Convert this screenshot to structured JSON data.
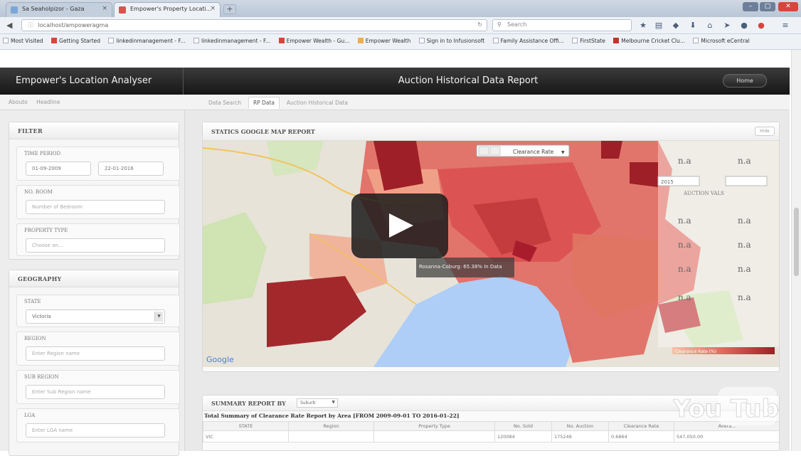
{
  "browser": {
    "tabs": [
      {
        "label": "Sa Seaholpizor - Gaza"
      },
      {
        "label": "Empower's Property Locati..."
      }
    ],
    "url": "localhost/ampoweragma",
    "search_placeholder": "Search",
    "bookmarks": [
      "Most Visited",
      "Getting Started",
      "linkedinmanagement - F...",
      "linkedinmanagement - F...",
      "Empower Wealth - Gu...",
      "Empower Wealth",
      "Sign in to Infusionsoft",
      "Family Assistance Offi...",
      "FirstState",
      "Melbourne Cricket Clu...",
      "Microsoft eCentral"
    ]
  },
  "header": {
    "app_name": "Empower's Location Analyser",
    "report_title": "Auction Historical Data Report",
    "home_label": "Home"
  },
  "subnav": {
    "left_links": [
      "Abouto",
      "Headline"
    ],
    "tabs": [
      "Data Search",
      "RP Data",
      "Auction Historical Data"
    ]
  },
  "filter": {
    "title": "FILTER",
    "time_period_label": "TIME PERIOD",
    "date_from": "01-09-2009",
    "date_to": "22-01-2016",
    "bedroom_label": "NO. ROOM",
    "bedroom_placeholder": "Number of Bedroom",
    "property_type_label": "PROPERTY TYPE",
    "property_type_placeholder": "Choose an..."
  },
  "geography": {
    "title": "GEOGRAPHY",
    "state_label": "STATE",
    "state_value": "Victoria",
    "region_label": "REGION",
    "region_placeholder": "Enter Region name",
    "subregion_label": "SUB REGION",
    "subregion_placeholder": "Enter Sub Region name",
    "lga_label": "LGA",
    "lga_placeholder": "Enter LGA name"
  },
  "map": {
    "title": "STATICS GOOGLE MAP REPORT",
    "hide_label": "Hide",
    "metric_select": "Clearance Rate",
    "google_label": "Google",
    "legend_label": "Clearance Rate (%)",
    "na_label": "n.a",
    "year_select": "2015",
    "auction_label": "AUCTION VALS",
    "tooltip": "Rosanna-Coburg: 65.38% In Data",
    "colors": {
      "low": "#f6c2a9",
      "mid": "#e0685f",
      "high": "#9e1f27",
      "water": "#aecdf7",
      "land": "#e7e3d8"
    }
  },
  "play_overlay": {
    "icon": "play-icon"
  },
  "summary": {
    "title": "SUMMARY REPORT BY",
    "group_by": "Suburb",
    "subtitle": "Total Summary of Clearance Rate Report by Area [FROM 2009-09-01 TO 2016-01-22]",
    "columns": [
      "STATE",
      "Region",
      "Property Type",
      "No. Sold",
      "No. Auction",
      "Clearance Rate",
      "Avera..."
    ],
    "rows": [
      [
        "VIC",
        "",
        "",
        "120084",
        "175249",
        "0.6864",
        "547,050.00"
      ]
    ]
  },
  "watermark": {
    "text": "You Tube"
  }
}
